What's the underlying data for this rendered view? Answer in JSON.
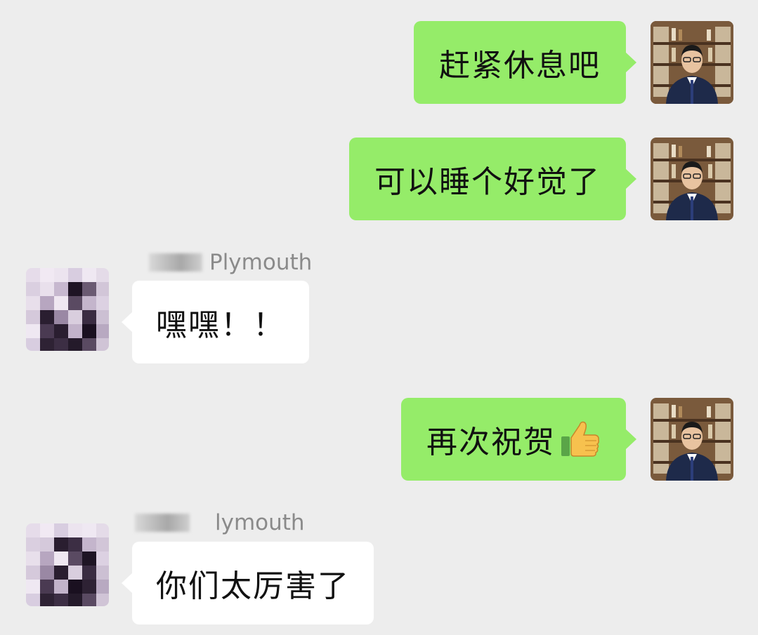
{
  "messages": [
    {
      "side": "me",
      "text": "赶紧休息吧"
    },
    {
      "side": "me",
      "text": "可以睡个好觉了"
    },
    {
      "side": "other",
      "sender_name": "Plymouth",
      "text": "嘿嘿！！"
    },
    {
      "side": "me",
      "text": "再次祝贺",
      "emoji_icon": "thumbs-up-icon"
    },
    {
      "side": "other",
      "sender_name": "lymouth",
      "text": "你们太厉害了"
    }
  ],
  "colors": {
    "background": "#ededed",
    "my_bubble": "#95ec69",
    "other_bubble": "#ffffff",
    "sender_name": "#8a8a8a"
  }
}
